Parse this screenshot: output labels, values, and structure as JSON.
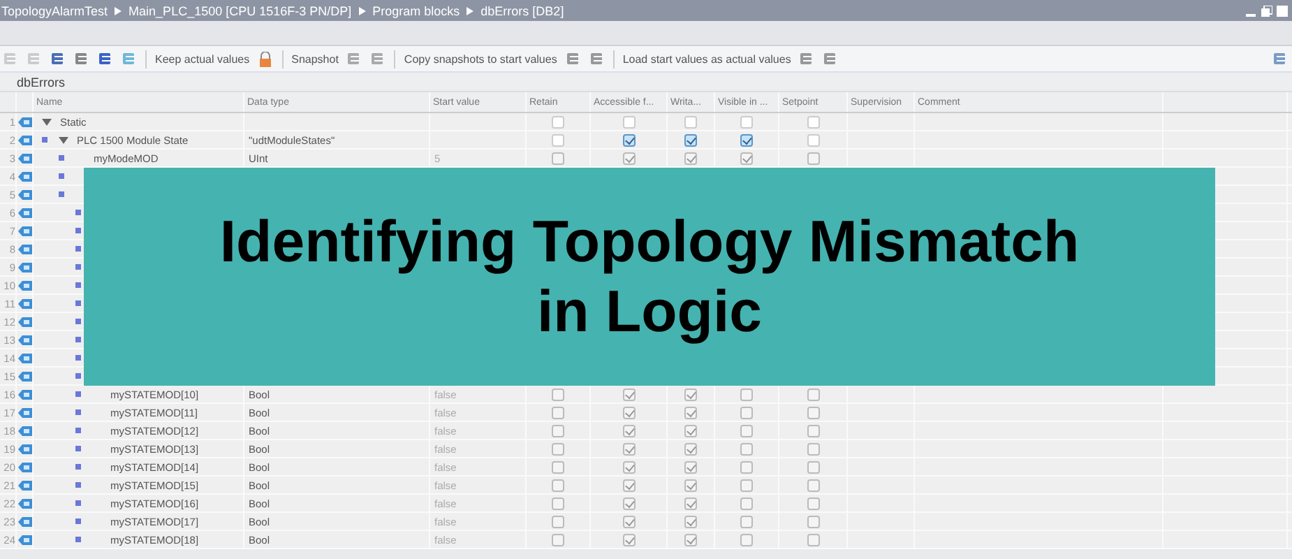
{
  "breadcrumb": [
    "TopologyAlarmTest",
    "Main_PLC_1500 [CPU 1516F-3 PN/DP]",
    "Program blocks",
    "dbErrors [DB2]"
  ],
  "toolbar": [
    "Keep actual values",
    "Snapshot",
    "Copy snapshots to start values",
    "Load start values as actual values"
  ],
  "block_name": "dbErrors",
  "columns": [
    "Name",
    "Data type",
    "Start value",
    "Retain",
    "Accessible f...",
    "Writa...",
    "Visible in ...",
    "Setpoint",
    "Supervision",
    "Comment"
  ],
  "rows": [
    {
      "number": "1",
      "name": "Static",
      "expanded": true,
      "checks": [
        false,
        false,
        false,
        false,
        false
      ],
      "greyed": false,
      "children": [
        {
          "number": "2",
          "name": "PLC 1500 Module State",
          "type": "\"udtModuleStates\"",
          "expanded": true,
          "checks": [
            false,
            true,
            true,
            true,
            false
          ],
          "greyed": false,
          "children": [
            {
              "number": "3",
              "name": "myModeMOD",
              "type": "UInt",
              "start": "5",
              "checks": [
                false,
                true,
                true,
                true,
                false
              ],
              "greyed": true
            },
            {
              "number": "4"
            },
            {
              "number": "5",
              "children": [
                {
                  "number": "6"
                },
                {
                  "number": "7"
                },
                {
                  "number": "8"
                },
                {
                  "number": "9"
                },
                {
                  "number": "10"
                },
                {
                  "number": "11"
                },
                {
                  "number": "12"
                },
                {
                  "number": "13"
                },
                {
                  "number": "14"
                },
                {
                  "number": "15"
                },
                {
                  "number": "16",
                  "name": "mySTATEMOD[10]",
                  "type": "Bool",
                  "start": "false",
                  "checks": [
                    false,
                    true,
                    true,
                    false,
                    false
                  ],
                  "greyed": true
                },
                {
                  "number": "17",
                  "name": "mySTATEMOD[11]",
                  "type": "Bool",
                  "start": "false",
                  "checks": [
                    false,
                    true,
                    true,
                    false,
                    false
                  ],
                  "greyed": true
                },
                {
                  "number": "18",
                  "name": "mySTATEMOD[12]",
                  "type": "Bool",
                  "start": "false",
                  "checks": [
                    false,
                    true,
                    true,
                    false,
                    false
                  ],
                  "greyed": true
                },
                {
                  "number": "19",
                  "name": "mySTATEMOD[13]",
                  "type": "Bool",
                  "start": "false",
                  "checks": [
                    false,
                    true,
                    true,
                    false,
                    false
                  ],
                  "greyed": true
                },
                {
                  "number": "20",
                  "name": "mySTATEMOD[14]",
                  "type": "Bool",
                  "start": "false",
                  "checks": [
                    false,
                    true,
                    true,
                    false,
                    false
                  ],
                  "greyed": true
                },
                {
                  "number": "21",
                  "name": "mySTATEMOD[15]",
                  "type": "Bool",
                  "start": "false",
                  "checks": [
                    false,
                    true,
                    true,
                    false,
                    false
                  ],
                  "greyed": true
                },
                {
                  "number": "22",
                  "name": "mySTATEMOD[16]",
                  "type": "Bool",
                  "start": "false",
                  "checks": [
                    false,
                    true,
                    true,
                    false,
                    false
                  ],
                  "greyed": true
                },
                {
                  "number": "23",
                  "name": "mySTATEMOD[17]",
                  "type": "Bool",
                  "start": "false",
                  "checks": [
                    false,
                    true,
                    true,
                    false,
                    false
                  ],
                  "greyed": true
                },
                {
                  "number": "24",
                  "name": "mySTATEMOD[18]",
                  "type": "Bool",
                  "start": "false",
                  "checks": [
                    false,
                    true,
                    true,
                    false,
                    false
                  ],
                  "greyed": true
                }
              ]
            }
          ]
        }
      ]
    }
  ],
  "banner": {
    "lines": [
      "Identifying Topology Mismatch",
      "in Logic"
    ]
  }
}
